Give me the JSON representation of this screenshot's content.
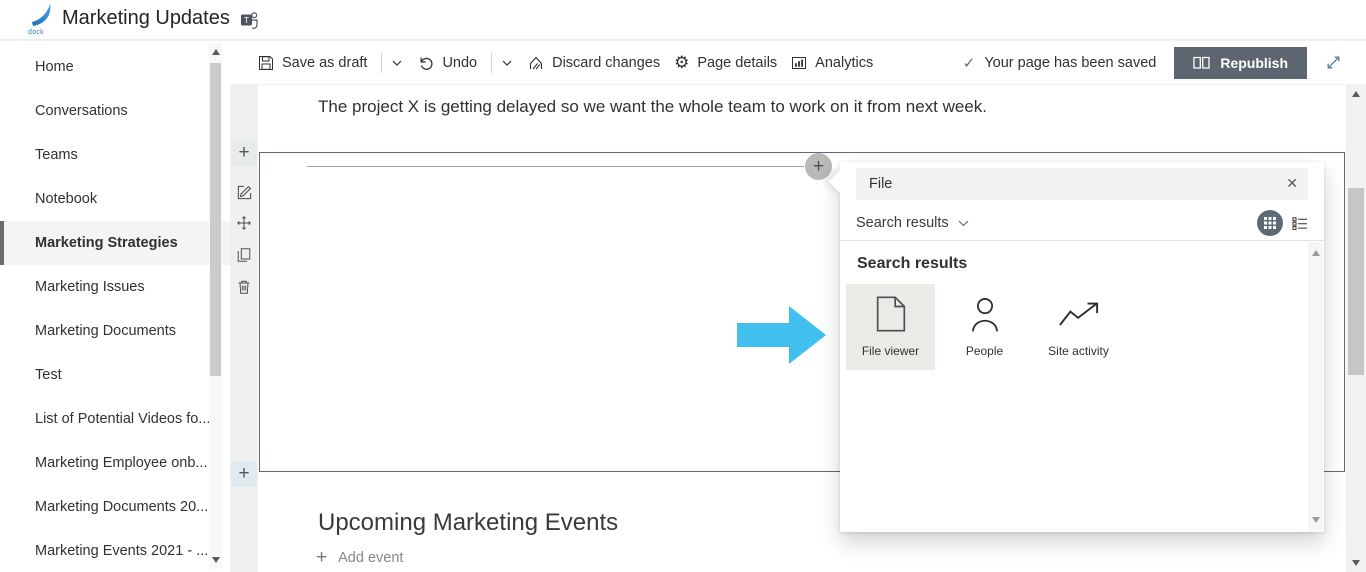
{
  "header": {
    "logo_text": "dock",
    "title": "Marketing Updates"
  },
  "sidebar": {
    "items": [
      {
        "label": "Home",
        "selected": false
      },
      {
        "label": "Conversations",
        "selected": false
      },
      {
        "label": "Teams",
        "selected": false
      },
      {
        "label": "Notebook",
        "selected": false
      },
      {
        "label": "Marketing Strategies",
        "selected": true
      },
      {
        "label": "Marketing Issues",
        "selected": false
      },
      {
        "label": "Marketing Documents",
        "selected": false
      },
      {
        "label": "Test",
        "selected": false
      },
      {
        "label": "List of Potential Videos fo...",
        "selected": false
      },
      {
        "label": "Marketing Employee onb...",
        "selected": false
      },
      {
        "label": "Marketing Documents 20...",
        "selected": false
      },
      {
        "label": "Marketing Events 2021 - ...",
        "selected": false
      }
    ]
  },
  "command_bar": {
    "save_as_draft": "Save as draft",
    "undo": "Undo",
    "discard_changes": "Discard changes",
    "page_details": "Page details",
    "analytics": "Analytics",
    "saved_status": "Your page has been saved",
    "republish": "Republish"
  },
  "canvas": {
    "paragraph": "The project X is getting delayed so we want the whole team to work on it from next week.",
    "events_heading": "Upcoming Marketing Events",
    "add_event_label": "Add event"
  },
  "webpart_panel": {
    "search_value": "File",
    "filter_dropdown": "Search results",
    "results_heading": "Search results",
    "results": [
      {
        "label": "File viewer",
        "icon": "file-document-icon",
        "selected": true
      },
      {
        "label": "People",
        "icon": "person-icon",
        "selected": false
      },
      {
        "label": "Site activity",
        "icon": "trending-up-icon",
        "selected": false
      }
    ]
  },
  "colors": {
    "pointer_arrow": "#41c0ef",
    "republish_button_bg": "#5d6670",
    "selection_border": "#5d6a75",
    "search_box_bg": "#f3f2f1",
    "selected_tile_bg": "#ebeae7"
  }
}
